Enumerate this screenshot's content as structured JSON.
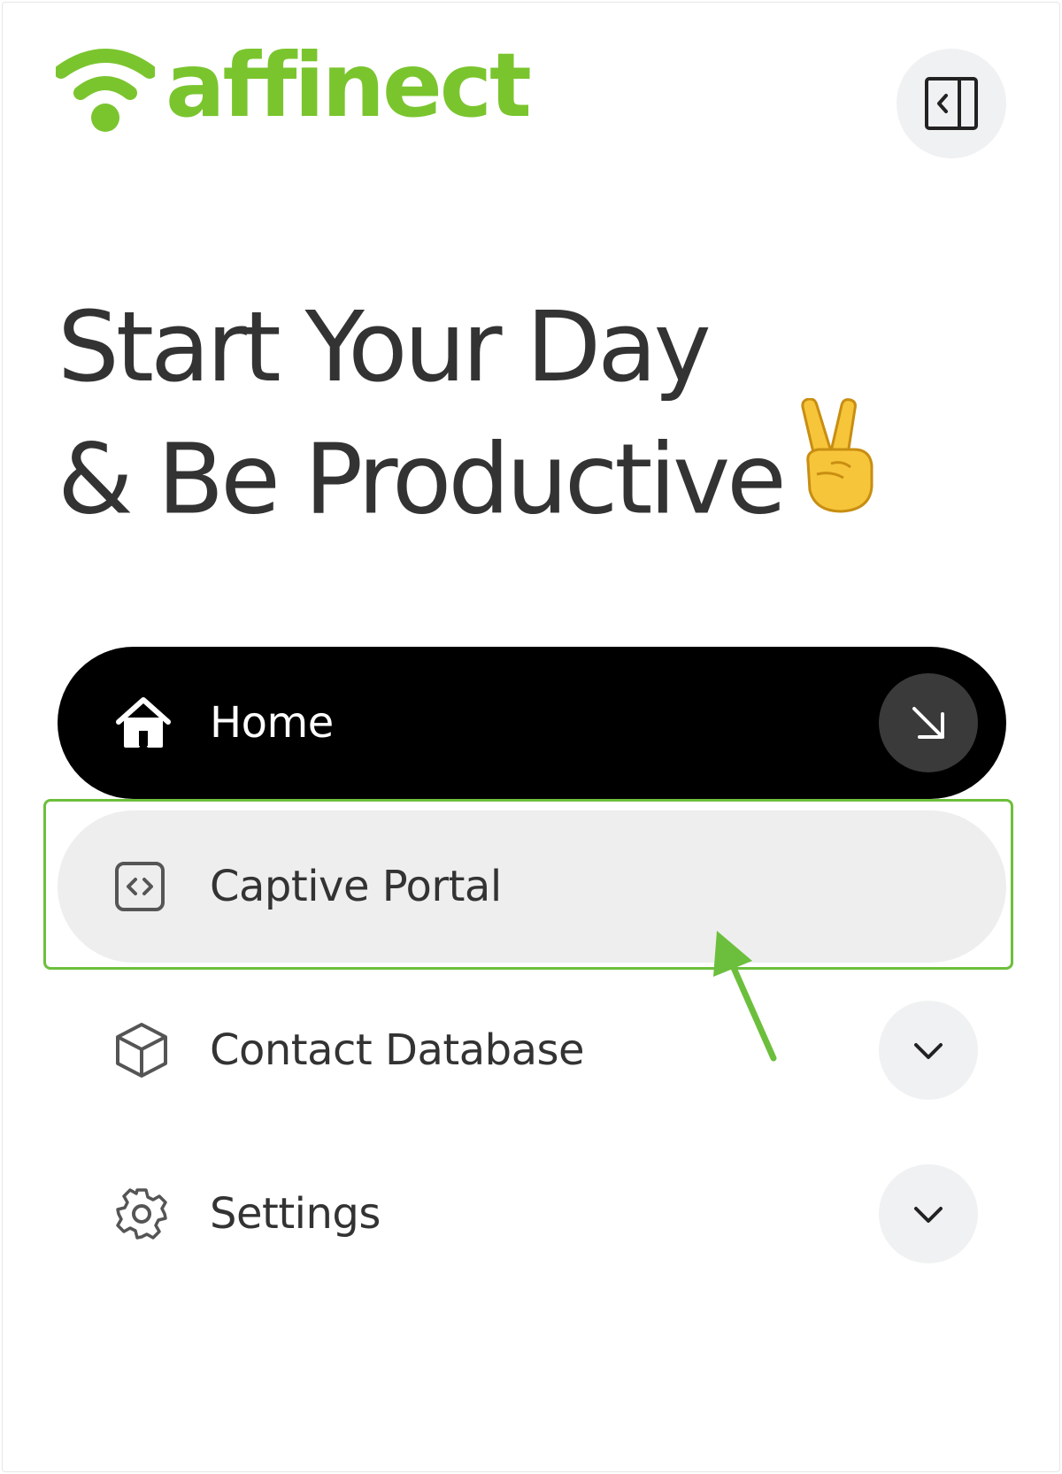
{
  "brand": {
    "name": "affinect",
    "color": "#7ac52e"
  },
  "header": {
    "collapse_icon": "sidebar-collapse-icon"
  },
  "greeting": {
    "line1": "Start Your Day",
    "line2": "& Be Productive",
    "emoji": "victory-hand-emoji"
  },
  "nav": {
    "items": [
      {
        "label": "Home",
        "icon": "home-icon",
        "active": true,
        "trailing": "arrow-down-right-icon"
      },
      {
        "label": "Captive Portal",
        "icon": "code-icon",
        "active": false,
        "hovered": true
      },
      {
        "label": "Contact Database",
        "icon": "cube-icon",
        "active": false,
        "trailing": "chevron-down-icon"
      },
      {
        "label": "Settings",
        "icon": "gear-icon",
        "active": false,
        "trailing": "chevron-down-icon"
      }
    ]
  },
  "annotation": {
    "highlight_color": "#6cbf3c",
    "target": "Captive Portal"
  }
}
